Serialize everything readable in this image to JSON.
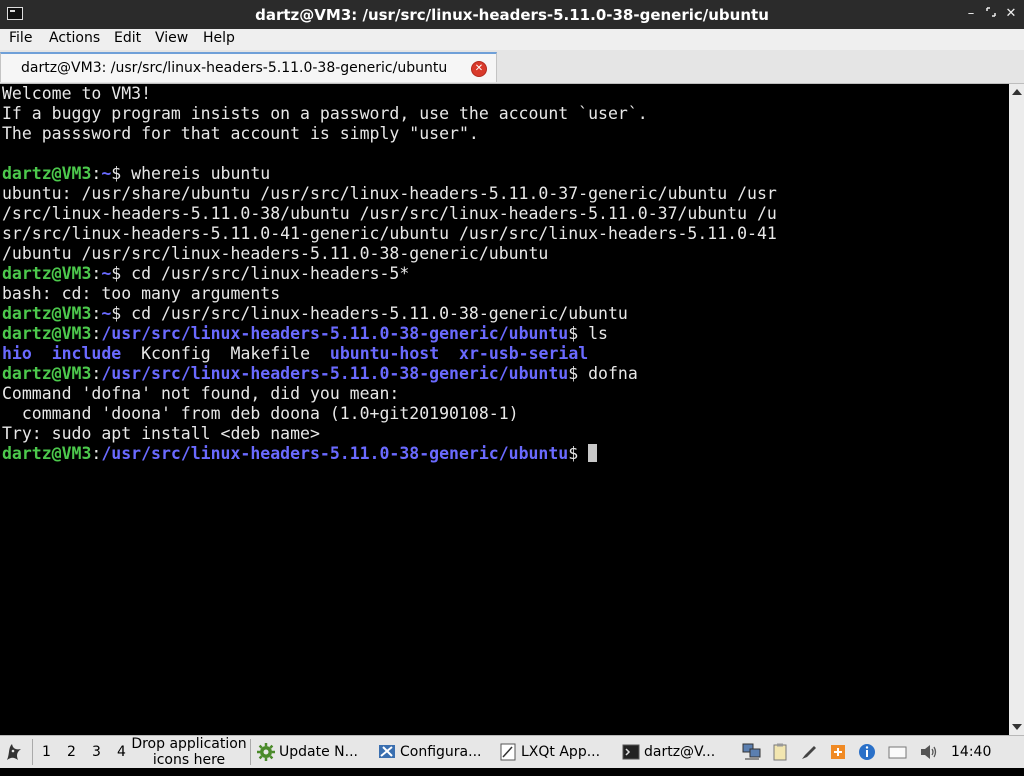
{
  "window": {
    "title": "dartz@VM3: /usr/src/linux-headers-5.11.0-38-generic/ubuntu",
    "controls": [
      "–",
      "✕"
    ]
  },
  "menubar": {
    "items": [
      "File",
      "Actions",
      "Edit",
      "View",
      "Help"
    ]
  },
  "tab": {
    "label": "dartz@VM3: /usr/src/linux-headers-5.11.0-38-generic/ubuntu"
  },
  "terminal": {
    "prompt_user": "dartz@VM3",
    "lines": [
      "Welcome to VM3!",
      "If a buggy program insists on a password, use the account `user`.",
      "The passsword for that account is simply \"user\".",
      "",
      {
        "cwd": "~",
        "cmd": " whereis ubuntu"
      },
      "ubuntu: /usr/share/ubuntu /usr/src/linux-headers-5.11.0-37-generic/ubuntu /usr",
      "/src/linux-headers-5.11.0-38/ubuntu /usr/src/linux-headers-5.11.0-37/ubuntu /u",
      "sr/src/linux-headers-5.11.0-41-generic/ubuntu /usr/src/linux-headers-5.11.0-41",
      "/ubuntu /usr/src/linux-headers-5.11.0-38-generic/ubuntu",
      {
        "cwd": "~",
        "cmd": " cd /usr/src/linux-headers-5*"
      },
      "bash: cd: too many arguments",
      {
        "cwd": "~",
        "cmd": " cd /usr/src/linux-headers-5.11.0-38-generic/ubuntu"
      },
      {
        "cwd": "/usr/src/linux-headers-5.11.0-38-generic/ubuntu",
        "cmd": " ls"
      },
      {
        "ls": [
          {
            "name": "hio",
            "dir": true
          },
          {
            "name": "include",
            "dir": true
          },
          {
            "name": "Kconfig",
            "dir": false
          },
          {
            "name": "Makefile",
            "dir": false
          },
          {
            "name": "ubuntu-host",
            "dir": true
          },
          {
            "name": "xr-usb-serial",
            "dir": true
          }
        ]
      },
      {
        "cwd": "/usr/src/linux-headers-5.11.0-38-generic/ubuntu",
        "cmd": " dofna"
      },
      "Command 'dofna' not found, did you mean:",
      "  command 'doona' from deb doona (1.0+git20190108-1)",
      "Try: sudo apt install <deb name>",
      {
        "cwd": "/usr/src/linux-headers-5.11.0-38-generic/ubuntu",
        "cmd": " ",
        "cursor": true
      }
    ]
  },
  "taskbar": {
    "desktops": [
      "1",
      "2",
      "3",
      "4"
    ],
    "drop_hint": [
      "Drop application",
      "icons here"
    ],
    "tasks": [
      {
        "label": "Update N...",
        "icon": "gear-update-icon"
      },
      {
        "label": "Configura...",
        "icon": "settings-icon"
      },
      {
        "label": "LXQt App...",
        "icon": "document-icon"
      },
      {
        "label": "dartz@V...",
        "icon": "terminal-icon"
      }
    ],
    "tray_icons": [
      "network-icon",
      "clipboard-icon",
      "pen-icon",
      "notes-icon",
      "info-icon",
      "battery-icon",
      "volume-icon"
    ],
    "clock": "14:40"
  },
  "colors": {
    "prompt_user": "#4cc94c",
    "prompt_path": "#6a6aff",
    "terminal_bg": "#000000",
    "terminal_fg": "#e8e8e8"
  }
}
